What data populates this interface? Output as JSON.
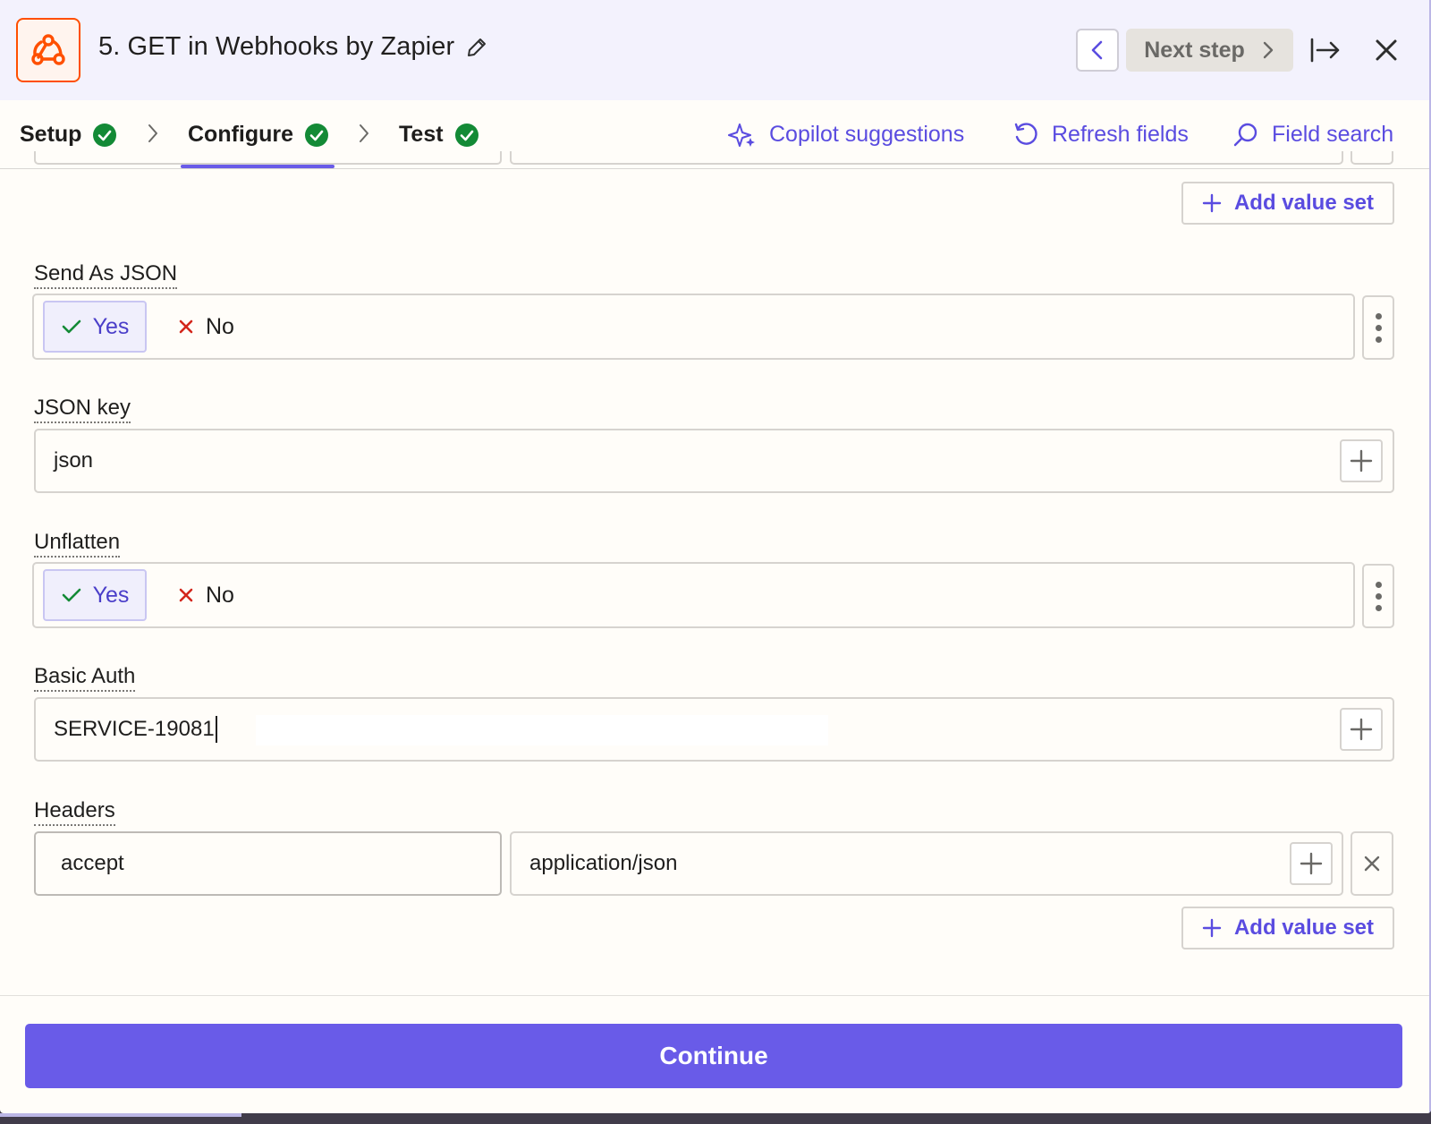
{
  "header": {
    "title": "5. GET in Webhooks by Zapier",
    "app_icon": "webhook-icon",
    "next_step_label": "Next step",
    "accent_color": "#ff4f00"
  },
  "tabs": {
    "items": [
      {
        "label": "Setup",
        "status": "complete"
      },
      {
        "label": "Configure",
        "status": "complete",
        "active": true
      },
      {
        "label": "Test",
        "status": "complete"
      }
    ],
    "actions": {
      "copilot": "Copilot suggestions",
      "refresh": "Refresh fields",
      "search": "Field search"
    }
  },
  "form": {
    "add_value_set_label": "Add value set",
    "send_as_json": {
      "label": "Send As JSON",
      "yes": "Yes",
      "no": "No",
      "selected": "Yes"
    },
    "json_key": {
      "label": "JSON key",
      "value": "json"
    },
    "unflatten": {
      "label": "Unflatten",
      "yes": "Yes",
      "no": "No",
      "selected": "Yes"
    },
    "basic_auth": {
      "label": "Basic Auth",
      "value": "SERVICE-19081"
    },
    "headers": {
      "label": "Headers",
      "key": "accept",
      "value": "application/json"
    }
  },
  "footer": {
    "continue_label": "Continue"
  },
  "colors": {
    "primary": "#695be8",
    "success": "#138a36",
    "danger": "#d3261b"
  }
}
